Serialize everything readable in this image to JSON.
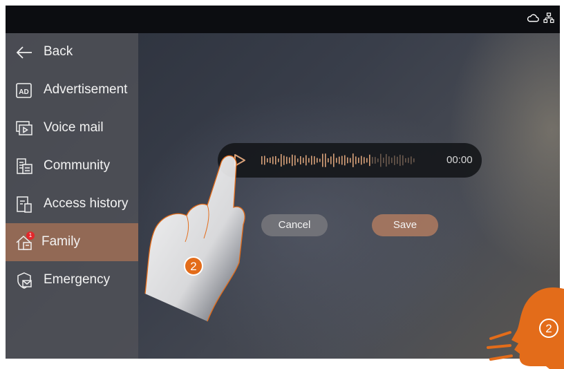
{
  "sidebar": {
    "items": [
      {
        "label": "Back",
        "icon": "back-arrow-icon"
      },
      {
        "label": "Advertisement",
        "icon": "ad-icon"
      },
      {
        "label": "Voice mail",
        "icon": "voice-mail-icon"
      },
      {
        "label": "Community",
        "icon": "community-icon"
      },
      {
        "label": "Access history",
        "icon": "access-history-icon"
      },
      {
        "label": "Family",
        "icon": "family-icon",
        "active": true,
        "badge": "1"
      },
      {
        "label": "Emergency",
        "icon": "emergency-icon"
      }
    ]
  },
  "status": {
    "icons": [
      "cloud-icon",
      "network-icon"
    ]
  },
  "player": {
    "time": "00:00",
    "play_icon": "play-icon"
  },
  "actions": {
    "cancel_label": "Cancel",
    "save_label": "Save"
  },
  "callouts": {
    "hand_step": "2",
    "voice_step": "2"
  },
  "colors": {
    "accent": "#e36c1a",
    "active_item": "#aa7355",
    "save_button": "#aa785f"
  }
}
